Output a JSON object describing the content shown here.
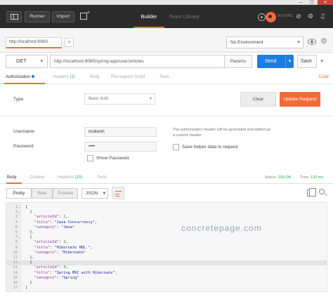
{
  "window": {
    "minimize": "—",
    "maximize": "☐",
    "close": "✕"
  },
  "header": {
    "runner_label": "Runner",
    "import_label": "Import",
    "builder_tab": "Builder",
    "team_library_tab": "Team Library",
    "sync_status": "IN SYNC"
  },
  "tabs": {
    "request_tab_label": "http://localhost:8080/",
    "add_tab": "+",
    "environment": "No Environment"
  },
  "request": {
    "method": "GET",
    "url": "http://localhost:8080/spring-app/user/articles",
    "params_label": "Params",
    "send_label": "Send",
    "save_label": "Save"
  },
  "request_tabs": {
    "authorization": "Authorization",
    "headers": "Headers",
    "headers_count": "(1)",
    "body": "Body",
    "pre_request": "Pre-request Script",
    "tests": "Tests",
    "code": "Code"
  },
  "auth": {
    "type_label": "Type",
    "type_value": "Basic Auth",
    "clear_label": "Clear",
    "update_label": "Update Request",
    "username_label": "Username",
    "username_value": "mukesh",
    "password_label": "Password",
    "password_value": "••••",
    "show_password_label": "Show Password",
    "note": "The authorization header will be generated and added as a custom header",
    "save_helper_label": "Save helper data to request"
  },
  "response_tabs": {
    "body": "Body",
    "cookies": "Cookies",
    "headers": "Headers",
    "headers_count": "(10)",
    "tests": "Tests",
    "status_label": "Status:",
    "status_value": "200 OK",
    "time_label": "Time:",
    "time_value": "133 ms"
  },
  "response_toolbar": {
    "pretty": "Pretty",
    "raw": "Raw",
    "preview": "Preview",
    "format": "JSON"
  },
  "code_lines": [
    "[",
    "  {",
    "    \"articleId\": 1,",
    "    \"title\": \"Java Concurrency\",",
    "    \"category\": \"Java\"",
    "  },",
    "  {",
    "    \"articleId\": 2,",
    "    \"title\": \"Hibernate HQL \",",
    "    \"category\": \"Hibernate\"",
    "  },",
    "  {",
    "    \"articleId\": 3,",
    "    \"title\": \"Spring MVC with Hibernate\",",
    "    \"category\": \"Spring\"",
    "  }",
    "]"
  ],
  "watermark": "concretepage.com",
  "colors": {
    "accent": "#f26b3a",
    "send": "#1f7de0",
    "header_bg": "#2b2b2b",
    "success": "#2ea44f"
  }
}
